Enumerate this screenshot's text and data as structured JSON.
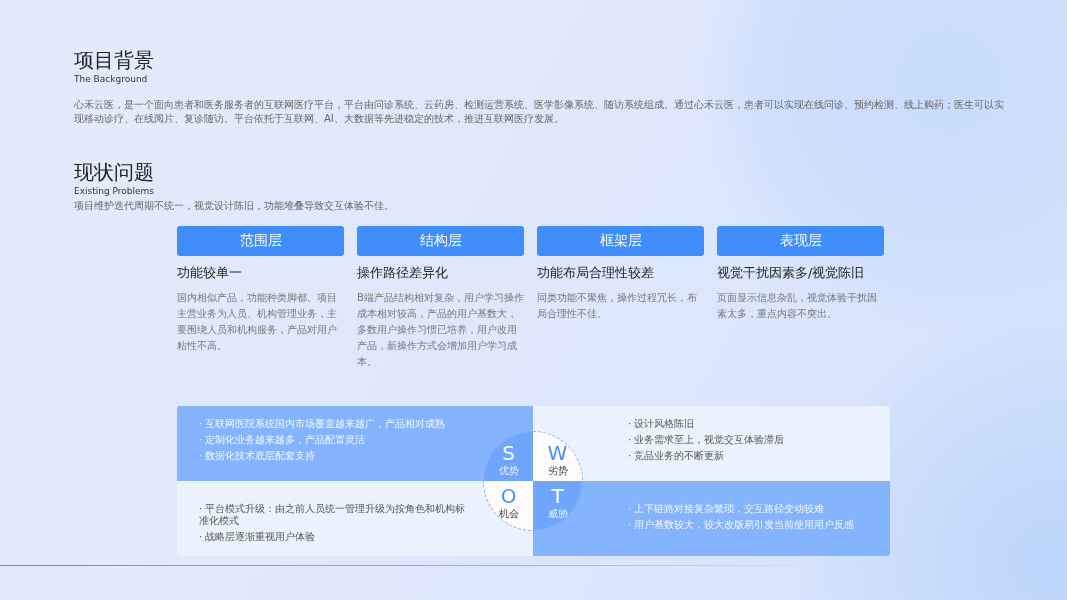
{
  "background": {
    "title": "项目背景",
    "subtitle": "The Background",
    "text": "心禾云医，是一个面向患者和医务服务者的互联网医疗平台，平台由问诊系统、云药房、检测运营系统、医学影像系统、随访系统组成。通过心禾云医，患者可以实现在线问诊、预约检测、线上购药；医生可以实现移动诊疗、在线阅片、复诊随访。平台依托于互联网、AI、大数据等先进稳定的技术，推进互联网医疗发展。"
  },
  "problems": {
    "title": "现状问题",
    "subtitle": "Existing Problems",
    "text": "项目维护迭代周期不统一，视觉设计陈旧，功能堆叠导致交互体验不佳。",
    "cards": [
      {
        "label": "范围层",
        "heading": "功能较单一",
        "text": "国内相似产品，功能种类脚都。项目主营业务为人员、机构管理业务，主要围绕人员和机构服务，产品对用户粘性不高。"
      },
      {
        "label": "结构层",
        "heading": "操作路径差异化",
        "text": "B端产品结构相对复杂，用户学习操作成本相对较高，产品的用户基数大，多数用户操作习惯已培养，用户改用产品，新操作方式会增加用户学习成本。"
      },
      {
        "label": "框架层",
        "heading": "功能布局合理性较差",
        "text": "同类功能不聚焦，操作过程冗长，布局合理性不佳。"
      },
      {
        "label": "表现层",
        "heading": "视觉干扰因素多/视觉陈旧",
        "text": "页面显示信息杂乱，视觉体验干扰因素太多，重点内容不突出。"
      }
    ]
  },
  "swot": [
    {
      "letter": "S",
      "label": "优势",
      "filled": true,
      "items": [
        "· 互联网医院系统国内市场覆盖越来越广，产品相对成熟",
        "· 定制化业务越来越多，产品配置灵活",
        "· 数据化技术底层配套支持"
      ]
    },
    {
      "letter": "W",
      "label": "劣势",
      "filled": false,
      "items": [
        "· 设计风格陈旧",
        "· 业务需求至上，视觉交互体验滞后",
        "· 竞品业务的不断更新"
      ]
    },
    {
      "letter": "O",
      "label": "机会",
      "filled": false,
      "items": [
        "· 平台模式升级：由之前人员统一管理升级为按角色和机构标准化模式",
        "· 战略层逐渐重视用户体验"
      ]
    },
    {
      "letter": "T",
      "label": "威胁",
      "filled": true,
      "items": [
        "· 上下链路对接复杂繁琐，交互路径变动较难",
        "· 用户基数较大，较大改版易引发当前使用用户反感"
      ]
    }
  ]
}
